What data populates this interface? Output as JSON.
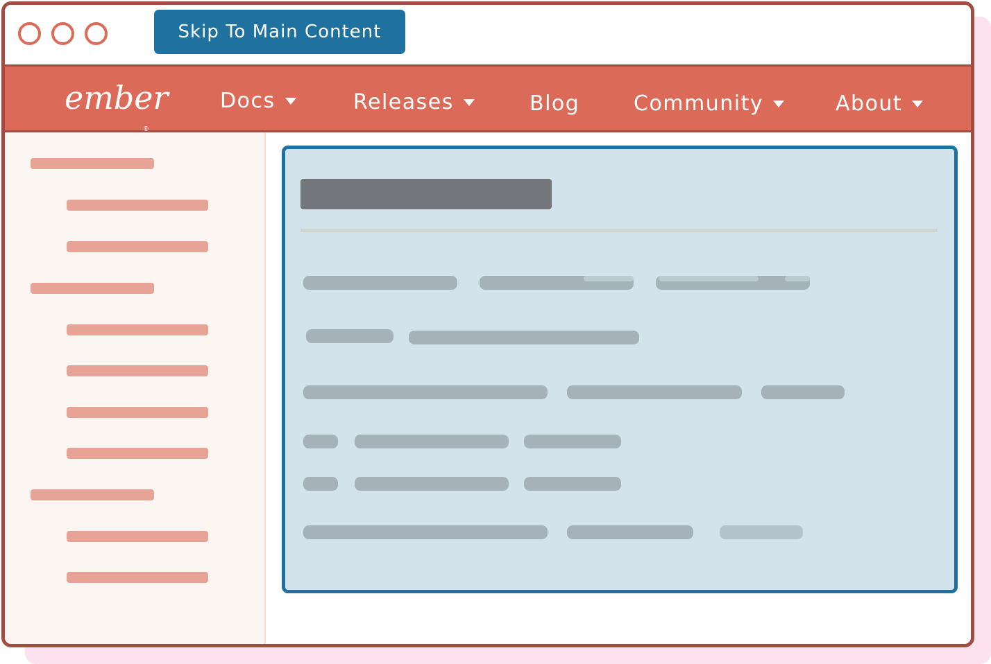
{
  "window": {
    "control_dots": [
      "close",
      "minimize",
      "maximize"
    ],
    "skip_link_label": "Skip To Main Content"
  },
  "navbar": {
    "logo_text": "ember",
    "logo_mark": "®",
    "items": [
      {
        "label": "Docs",
        "has_dropdown": true
      },
      {
        "label": "Releases",
        "has_dropdown": true
      },
      {
        "label": "Blog",
        "has_dropdown": false
      },
      {
        "label": "Community",
        "has_dropdown": true
      },
      {
        "label": "About",
        "has_dropdown": true
      }
    ]
  },
  "sidebar": {
    "placeholder": "skeleton navigation list",
    "groups": 3,
    "items_per_group": [
      2,
      4,
      2
    ]
  },
  "main": {
    "placeholder": "skeleton content block",
    "focused": true
  },
  "colors": {
    "brand": "#dc6a59",
    "frame": "#a14d42",
    "focus_blue": "#1f729f",
    "panel_bg": "#d3e3eb",
    "sidebar_bg": "#fbf6f1",
    "shadow": "#fde1ef"
  }
}
